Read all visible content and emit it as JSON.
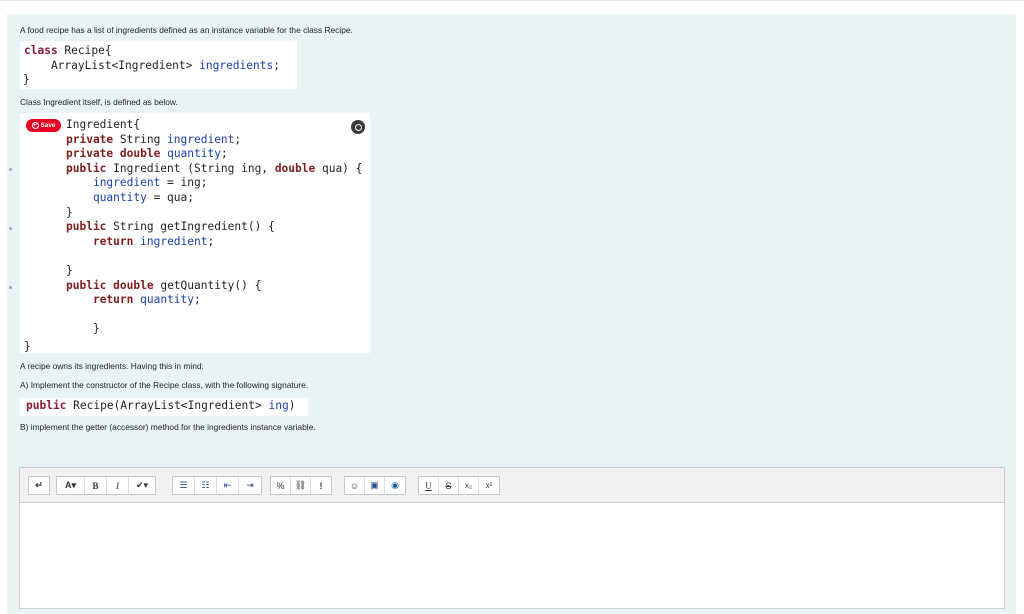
{
  "question": {
    "intro": "A food recipe has a list of ingredients defined as an instance variable for the class Recipe.",
    "ingredient_intro": "Class Ingredient itself, is defined as below.",
    "owns_text": "A recipe owns its ingredients. Having this in mind:",
    "part_a": "A) Implement the constructor of the Recipe class, with the following signature.",
    "part_b": "B) implement the getter (accessor) method for the ingredients instance variable."
  },
  "code": {
    "recipe_kw": "class",
    "recipe_name": " Recipe{",
    "recipe_field_type": "    ArrayList<Ingredient> ",
    "recipe_field_name": "ingredients",
    "recipe_field_end": ";",
    "recipe_close": "}",
    "ingredient_header": "Ingredient{",
    "ingredient_close": "}",
    "signature_kw": "public",
    "signature_rest": " Recipe(ArrayList<Ingredient> ",
    "signature_param": "ing",
    "signature_end": ")"
  },
  "pinterest": {
    "save_label": "Save"
  },
  "toolbar": {
    "paragraph": "↵",
    "font_color": "A▾",
    "bold": "B",
    "italic": "I",
    "brush": "✔▾",
    "bullet_list": "☰",
    "numbered_list": "☷",
    "outdent": "⇤",
    "indent": "⇥",
    "link": "%",
    "unlink": "⛓",
    "emphasis": "!",
    "emoji": "☺",
    "image": "▣",
    "media": "◉",
    "underline": "U",
    "strike": "S",
    "subscript": "x₂",
    "superscript": "x²"
  },
  "colors": {
    "panel": "#e7f3f5",
    "keyword": "#7d1d1d",
    "identifier": "#1a3fa8",
    "pinterest": "#e60023"
  },
  "icons": [
    "pinterest-save-icon",
    "lens-icon"
  ]
}
